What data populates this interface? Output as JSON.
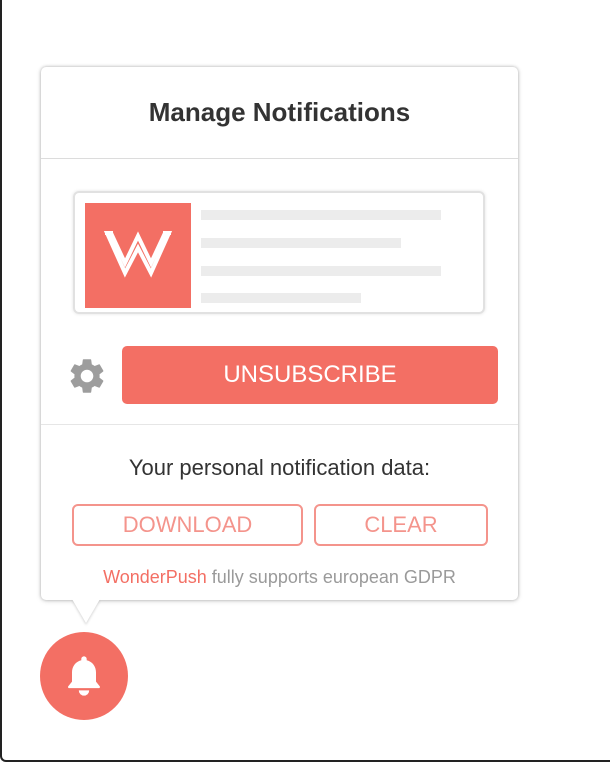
{
  "popup": {
    "title": "Manage Notifications",
    "unsubscribe_label": "UNSUBSCRIBE",
    "personal_data_label": "Your personal notification data:",
    "download_label": "DOWNLOAD",
    "clear_label": "CLEAR",
    "gdpr_brand": "WonderPush",
    "gdpr_text": " fully supports european GDPR"
  },
  "preview": {
    "logo_icon": "wonderpush-w-logo"
  },
  "icons": {
    "settings": "gear-icon",
    "bell": "bell-icon"
  },
  "colors": {
    "accent": "#f36f64",
    "accent_light": "#f4948c",
    "title_text": "#333333",
    "muted_text": "#9a9a9a"
  }
}
